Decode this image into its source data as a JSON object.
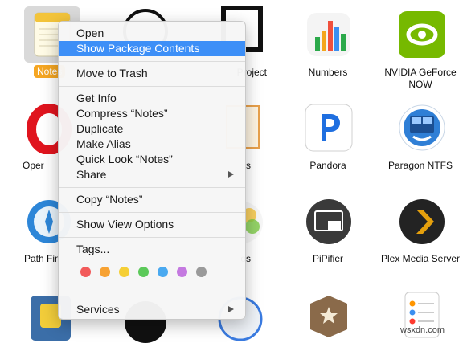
{
  "apps": {
    "notes": "Notes",
    "project": "Project",
    "numbers": "Numbers",
    "nvidia": "NVIDIA GeForce NOW",
    "opera": "Opera",
    "pages": "Pages",
    "pandora": "Pandora",
    "paragon": "Paragon NTFS",
    "pathfinder": "Path Finder",
    "photos": "Photos",
    "pipifier": "PiPifier",
    "plex": "Plex Media Server"
  },
  "menu": {
    "open": "Open",
    "show_package": "Show Package Contents",
    "move_trash": "Move to Trash",
    "get_info": "Get Info",
    "compress": "Compress “Notes”",
    "duplicate": "Duplicate",
    "make_alias": "Make Alias",
    "quick_look": "Quick Look “Notes”",
    "share": "Share",
    "copy": "Copy “Notes”",
    "view_options": "Show View Options",
    "tags": "Tags...",
    "services": "Services",
    "tag_colors": [
      "#f25a5a",
      "#f7a233",
      "#f5cf36",
      "#5cc95a",
      "#4aa9f0",
      "#c479e0",
      "#9a9a9a"
    ]
  },
  "colors": {
    "selection": "#3d8ff7",
    "notes_pill": "#f5a623"
  },
  "watermark": "wsxdn.com"
}
